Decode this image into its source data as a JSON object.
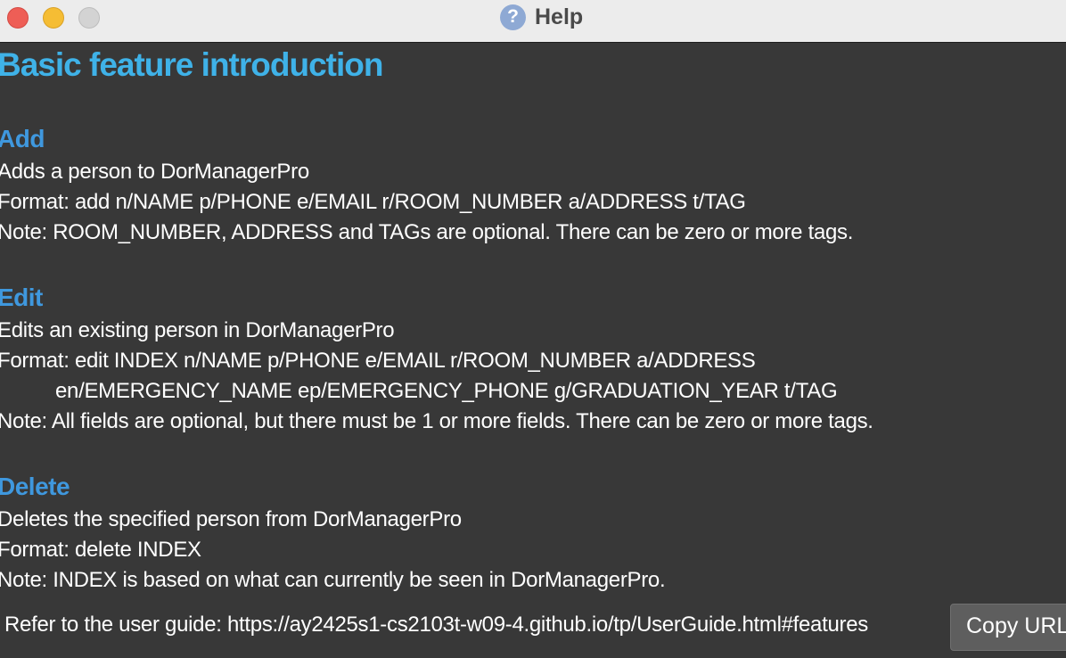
{
  "window": {
    "title": "Help",
    "help_icon_glyph": "?",
    "controls": [
      "close",
      "minimize",
      "zoom"
    ]
  },
  "content": {
    "heading": "Basic feature introduction",
    "sections": [
      {
        "title": "Add",
        "description": "Adds a person to DorManagerPro",
        "format": "Format: add n/NAME p/PHONE e/EMAIL r/ROOM_NUMBER a/ADDRESS t/TAG",
        "format_cont": "",
        "note": "Note: ROOM_NUMBER, ADDRESS and TAGs are optional. There can be zero or more tags."
      },
      {
        "title": "Edit",
        "description": "Edits an existing person in DorManagerPro",
        "format": "Format: edit INDEX n/NAME p/PHONE e/EMAIL r/ROOM_NUMBER a/ADDRESS",
        "format_cont": "en/EMERGENCY_NAME ep/EMERGENCY_PHONE g/GRADUATION_YEAR t/TAG",
        "note": "Note: All fields are optional, but there must be 1 or more fields. There can be zero or more tags."
      },
      {
        "title": "Delete",
        "description": "Deletes the specified person from DorManagerPro",
        "format": "Format: delete INDEX",
        "format_cont": "",
        "note": "Note: INDEX is based on what can currently be seen in DorManagerPro."
      }
    ]
  },
  "footer": {
    "text": "Refer to the user guide: https://ay2425s1-cs2103t-w09-4.github.io/tp/UserGuide.html#features",
    "copy_button_label": "Copy URL"
  },
  "colors": {
    "background": "#383838",
    "heading": "#3fb2e8",
    "section_title": "#3f98de",
    "text": "#ffffff",
    "button": "#5e5e5e"
  }
}
